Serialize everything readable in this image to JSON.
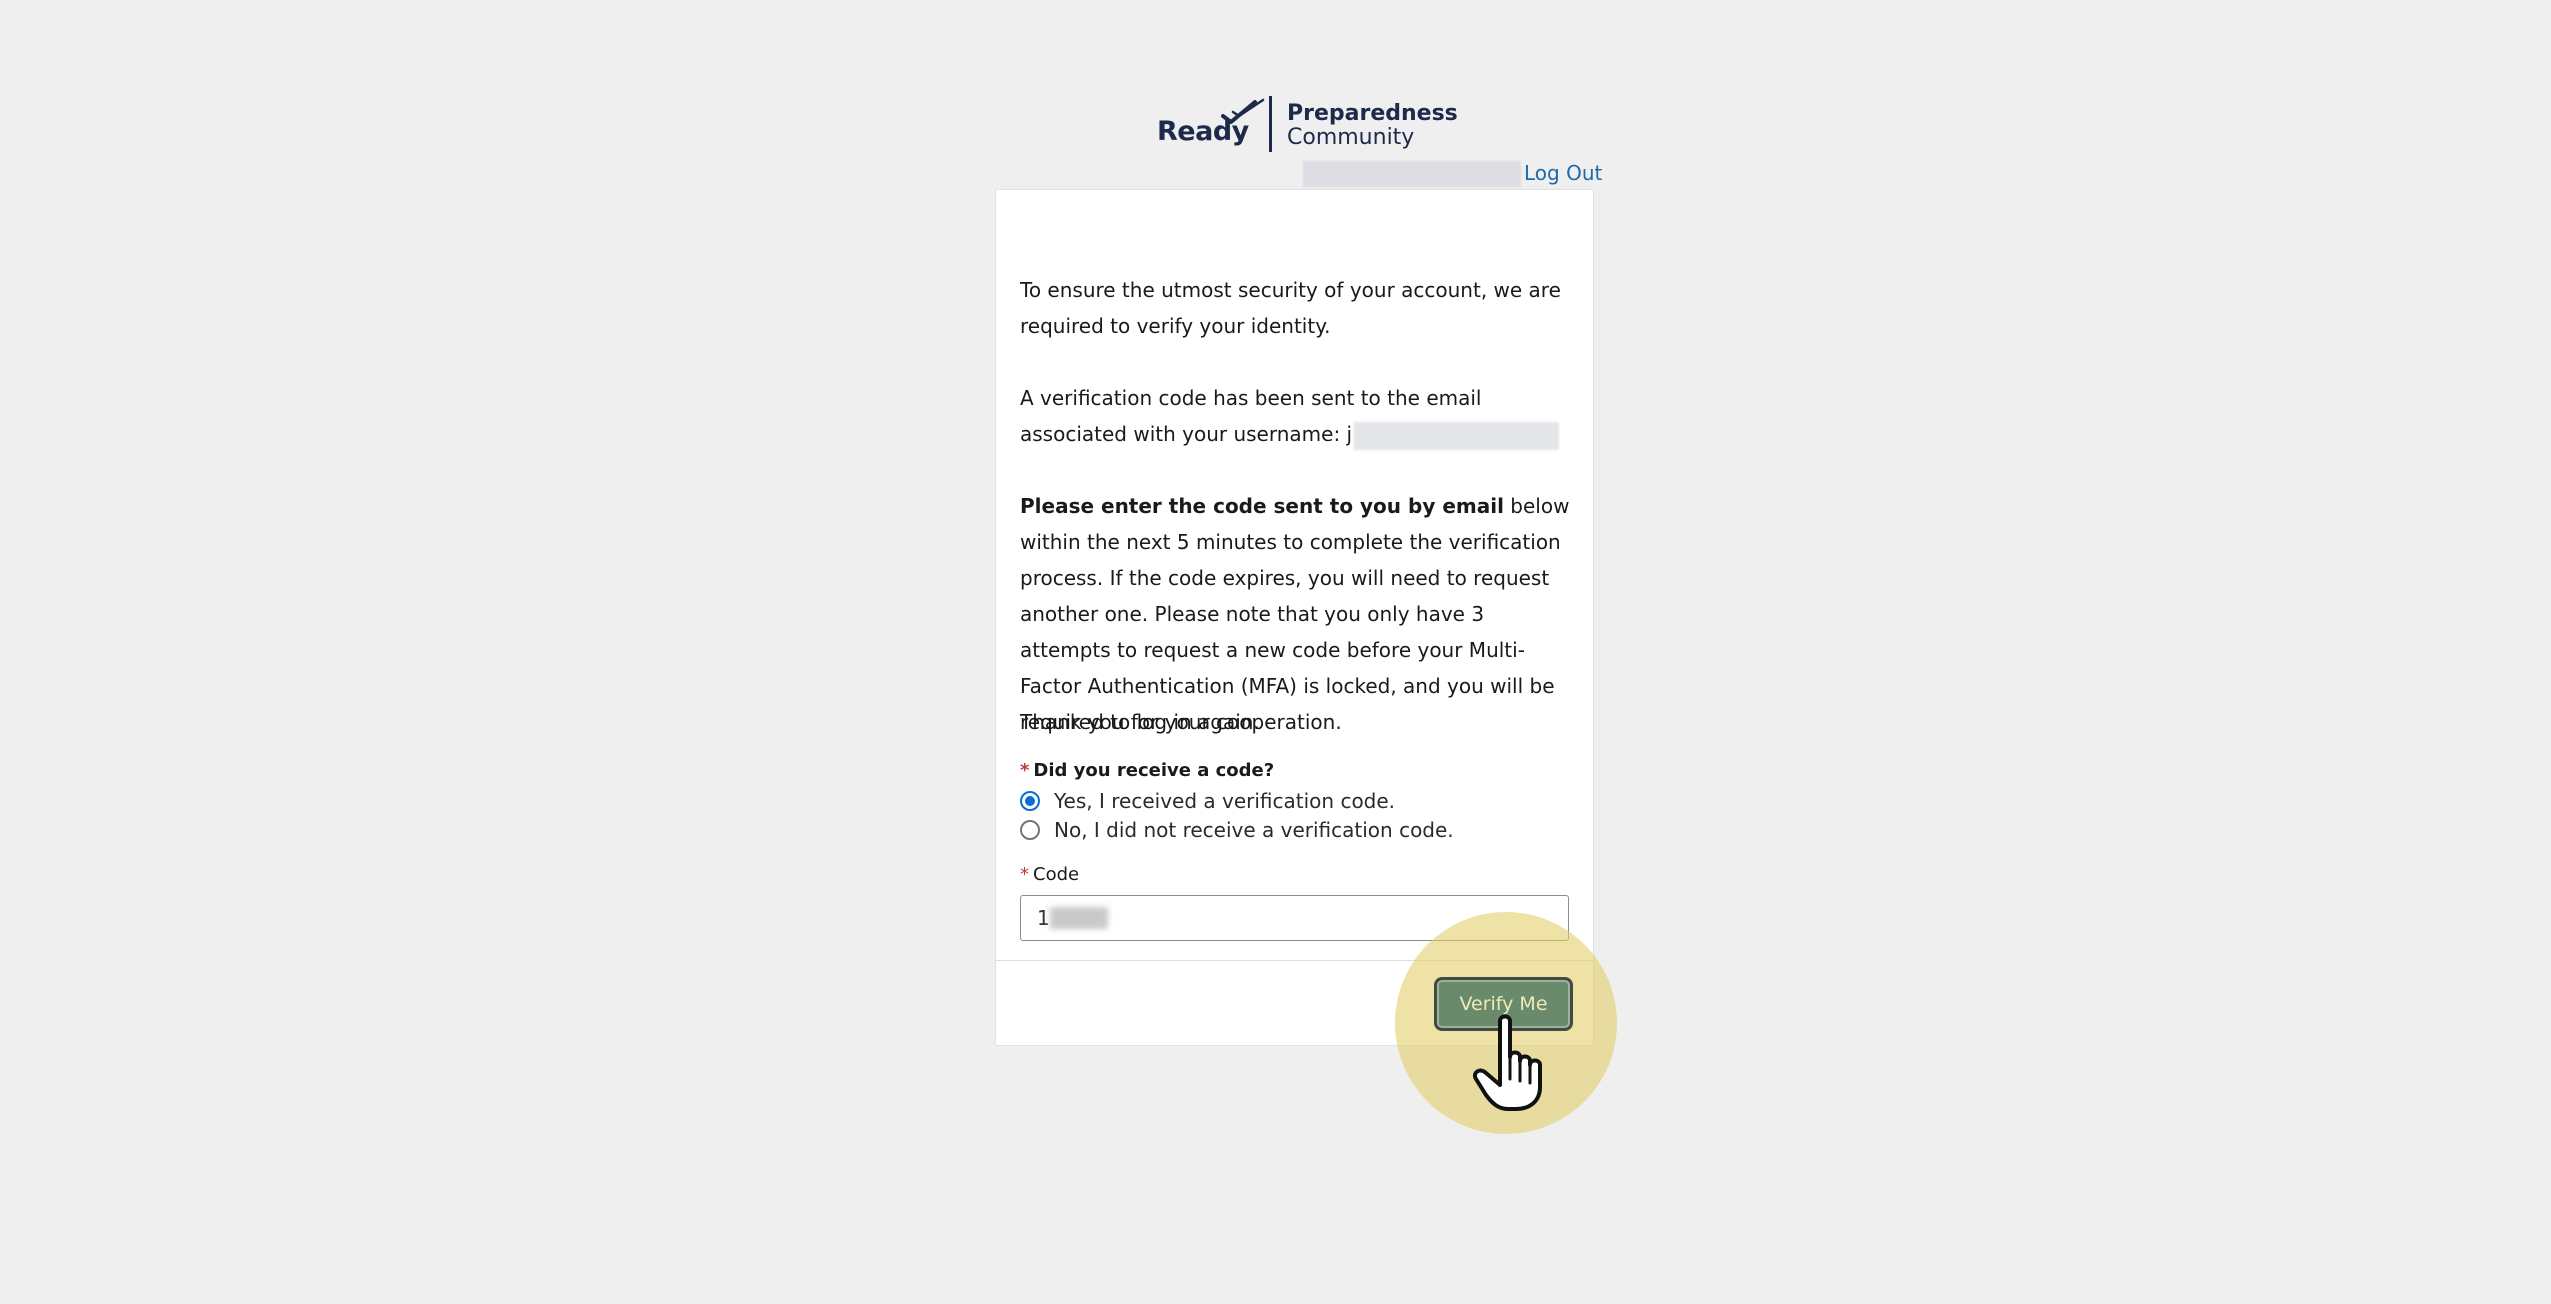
{
  "logo": {
    "ready": "Ready",
    "line1": "Preparedness",
    "line2": "Community"
  },
  "header": {
    "logout_label": "Log Out"
  },
  "message": {
    "p1": "To ensure the utmost security of your account, we are required to verify your identity.",
    "p2_prefix": "A verification code has been sent to the email associated with your username: j",
    "p3_bold": "Please enter the code sent to you by email",
    "p3_rest": " below within the next 5 minutes to complete the verification process. If the code expires, you will need to request another one. Please note that you only have 3 attempts to request a new code before your Multi-Factor Authentication (MFA) is locked, and you will be required to log in again.",
    "p4": "Thank you for your cooperation."
  },
  "form": {
    "required_mark": "*",
    "question": "Did you receive a code?",
    "options": [
      {
        "label": "Yes, I received a verification code.",
        "selected": true
      },
      {
        "label": "No, I did not receive a verification code.",
        "selected": false
      }
    ],
    "code_label": "Code",
    "code_value_prefix": "1"
  },
  "footer": {
    "verify_label": "Verify Me"
  },
  "colors": {
    "brand_navy": "#1d2a4b",
    "link": "#1f6aa8",
    "radio_selected": "#0b6ed4",
    "required": "#c23934",
    "button_bg": "#6a8a6c",
    "highlight": "#e2cd65"
  }
}
